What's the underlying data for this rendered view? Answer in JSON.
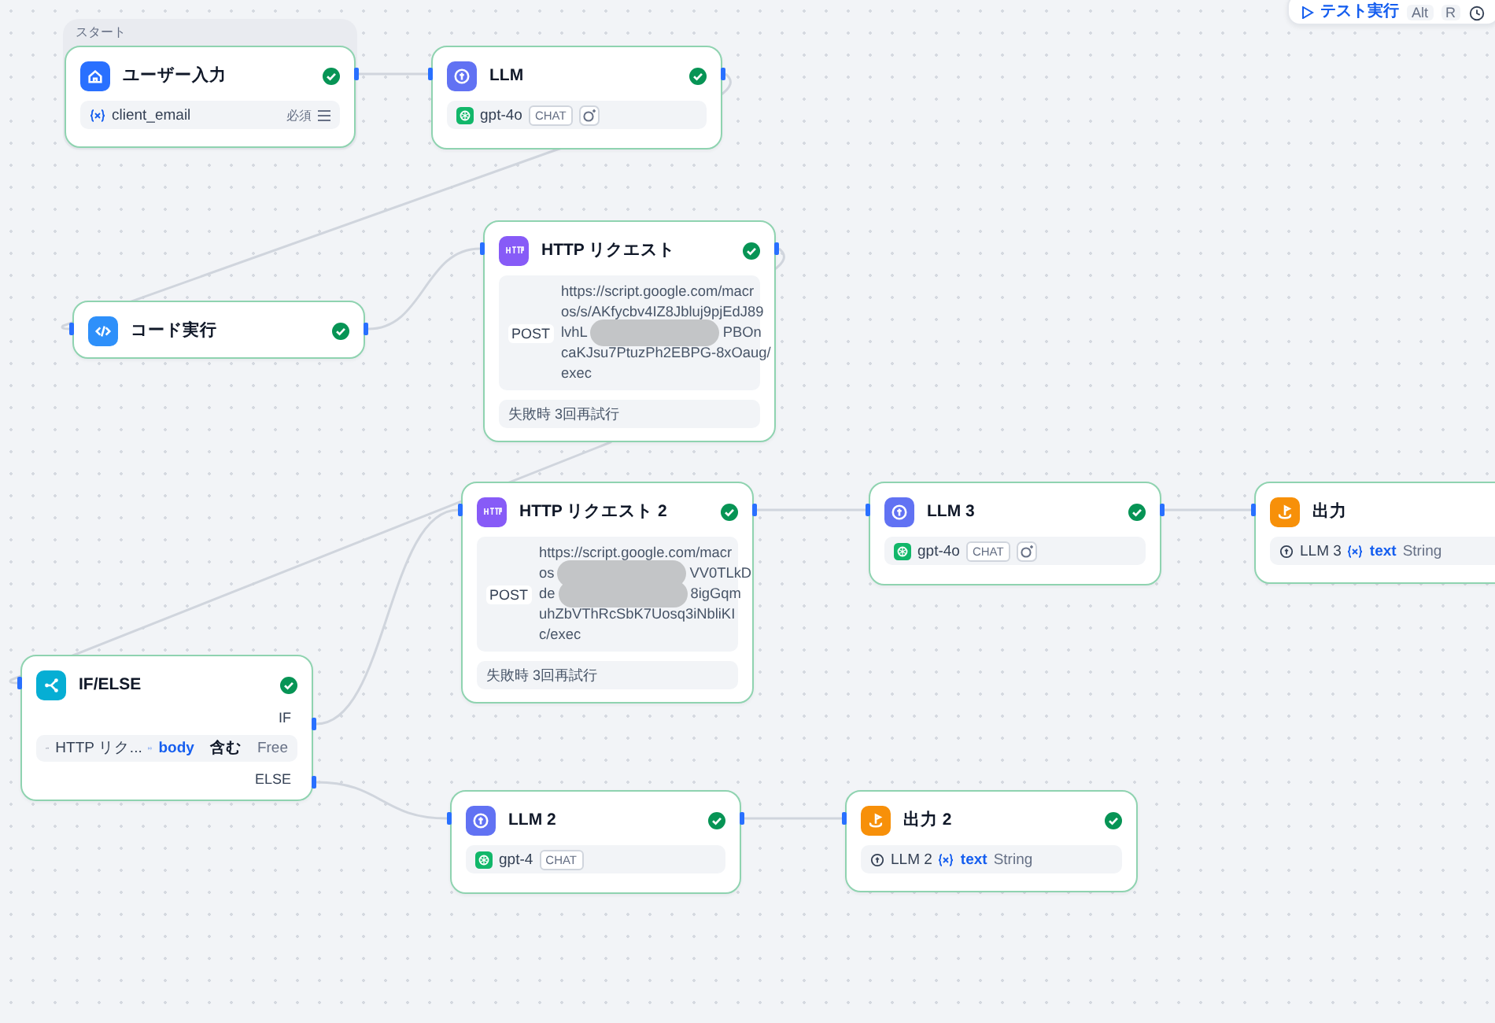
{
  "toolbar": {
    "run_label": "テスト実行",
    "keys": [
      "Alt",
      "R"
    ]
  },
  "nodes": [
    {
      "kind": "start",
      "group_label": "スタート",
      "title": "ユーザー入力",
      "checked": true,
      "variable": {
        "name": "client_email",
        "badge": "必須"
      }
    },
    {
      "kind": "llm",
      "title": "LLM",
      "checked": true,
      "model": {
        "name": "gpt-4o",
        "tag": "CHAT",
        "vision": true
      }
    },
    {
      "kind": "code",
      "title": "コード実行",
      "checked": true
    },
    {
      "kind": "http",
      "title": "HTTP リクエスト",
      "checked": true,
      "method": "POST",
      "url_lines": [
        {
          "text": "https://script.google.com/macr"
        },
        {
          "text": "os/s/AKfycbv4IZ8Jbluj9pjEdJ89"
        },
        {
          "text": "lvhL",
          "after": "PBOn",
          "redacted": true
        },
        {
          "text": "caKJsu7PtuzPh2EBPG-8xOaug/"
        },
        {
          "text": "exec"
        }
      ],
      "retry": "失敗時 3回再試行"
    },
    {
      "kind": "http",
      "title": "HTTP リクエスト 2",
      "checked": true,
      "method": "POST",
      "url_lines": [
        {
          "text": "https://script.google.com/macr"
        },
        {
          "text": "os",
          "after": "VV0TLkD",
          "redacted": true
        },
        {
          "text": "de",
          "after": "8igGqm",
          "redacted": true
        },
        {
          "text": "uhZbVThRcSbK7Uosq3iNbliKI"
        },
        {
          "text": "c/exec"
        }
      ],
      "retry": "失敗時 3回再試行"
    },
    {
      "kind": "llm",
      "title": "LLM 3",
      "checked": true,
      "model": {
        "name": "gpt-4o",
        "tag": "CHAT",
        "vision": true
      }
    },
    {
      "kind": "output",
      "title": "出力",
      "output": {
        "source": "LLM 3",
        "var": "text",
        "type": "String"
      }
    },
    {
      "kind": "ifelse",
      "title": "IF/ELSE",
      "checked": true,
      "branches": [
        "IF",
        "ELSE"
      ],
      "condition": {
        "source": "HTTP リク...",
        "var": "body",
        "operator": "含む",
        "value": "Free"
      }
    },
    {
      "kind": "llm",
      "title": "LLM 2",
      "checked": true,
      "model": {
        "name": "gpt-4",
        "tag": "CHAT",
        "vision": false
      }
    },
    {
      "kind": "output",
      "title": "出力 2",
      "checked": true,
      "output": {
        "source": "LLM 2",
        "var": "text",
        "type": "String"
      }
    }
  ]
}
